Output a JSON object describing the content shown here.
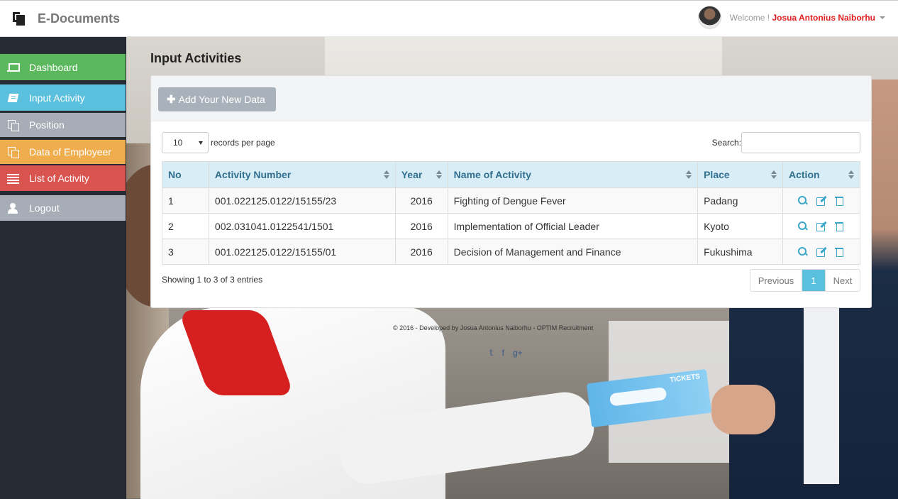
{
  "app": {
    "brand": "E-Documents"
  },
  "user": {
    "welcome_prefix": "Welcome ! ",
    "name": "Josua Antonius Naiborhu"
  },
  "sidebar": {
    "items": [
      {
        "label": "Dashboard",
        "icon": "laptop-icon",
        "color": "#5cb85c"
      },
      {
        "label": "Input Activity",
        "icon": "book-icon",
        "color": "#5bc0de"
      },
      {
        "label": "Position",
        "icon": "copy-icon",
        "color": "#a7adb6"
      },
      {
        "label": "Data of Employeer",
        "icon": "copy-icon",
        "color": "#f0ad4e"
      },
      {
        "label": "List of Activity",
        "icon": "list-icon",
        "color": "#d9534f"
      },
      {
        "label": "Logout",
        "icon": "user-icon",
        "color": "#a7adb6"
      }
    ]
  },
  "page": {
    "title": "Input Activities"
  },
  "toolbar": {
    "add_label": "Add Your New Data"
  },
  "table_controls": {
    "page_length": "10",
    "page_length_suffix": "records per page",
    "search_label": "Search:",
    "search_value": ""
  },
  "table": {
    "columns": [
      "No",
      "Activity Number",
      "Year",
      "Name of Activity",
      "Place",
      "Action"
    ],
    "rows": [
      {
        "no": "1",
        "number": "001.022125.0122/15155/23",
        "year": "2016",
        "name": "Fighting of Dengue Fever",
        "place": "Padang"
      },
      {
        "no": "2",
        "number": "002.031041.0122541/1501",
        "year": "2016",
        "name": "Implementation of Official Leader",
        "place": "Kyoto"
      },
      {
        "no": "3",
        "number": "001.022125.0122/15155/01",
        "year": "2016",
        "name": "Decision of Management and Finance",
        "place": "Fukushima"
      }
    ]
  },
  "pagination": {
    "info": "Showing 1 to 3 of 3 entries",
    "previous": "Previous",
    "current": "1",
    "next": "Next"
  },
  "footer": {
    "text": "© 2016 - Developed by Josua Antonius Naiborhu - OPTIM Recruitment",
    "social": [
      "twitter-icon",
      "facebook-icon",
      "google-plus-icon"
    ]
  },
  "colors": {
    "accent": "#5bc0de",
    "username": "#e02020",
    "table_header_bg": "#d9edf7"
  }
}
